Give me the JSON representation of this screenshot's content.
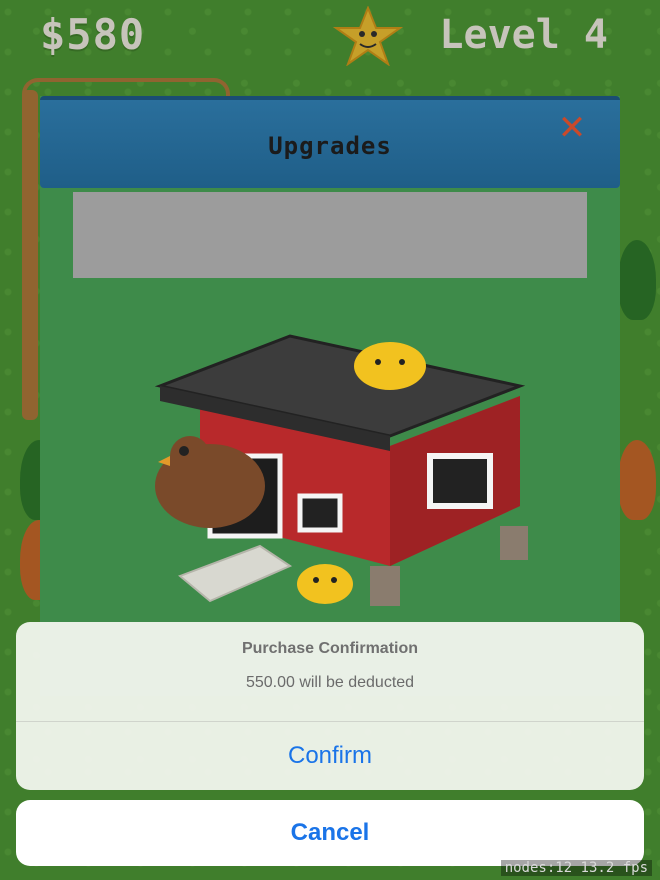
{
  "hud": {
    "money": "$580",
    "level": "Level 4",
    "star_icon": "star-icon"
  },
  "upgrades_panel": {
    "title": "Upgrades",
    "close_icon": "close-icon",
    "image": "chicken-coop-icon"
  },
  "action_sheet": {
    "title": "Purchase Confirmation",
    "message": "550.00 will be deducted",
    "confirm_label": "Confirm",
    "cancel_label": "Cancel"
  },
  "debug": {
    "text": "nodes:12  13.2 fps"
  },
  "colors": {
    "grass": "#4f9a36",
    "panel_green": "#3e8b4a",
    "header_blue": "#2a6f9c",
    "ios_blue": "#1a74e8",
    "close_red": "#c94a2a"
  }
}
